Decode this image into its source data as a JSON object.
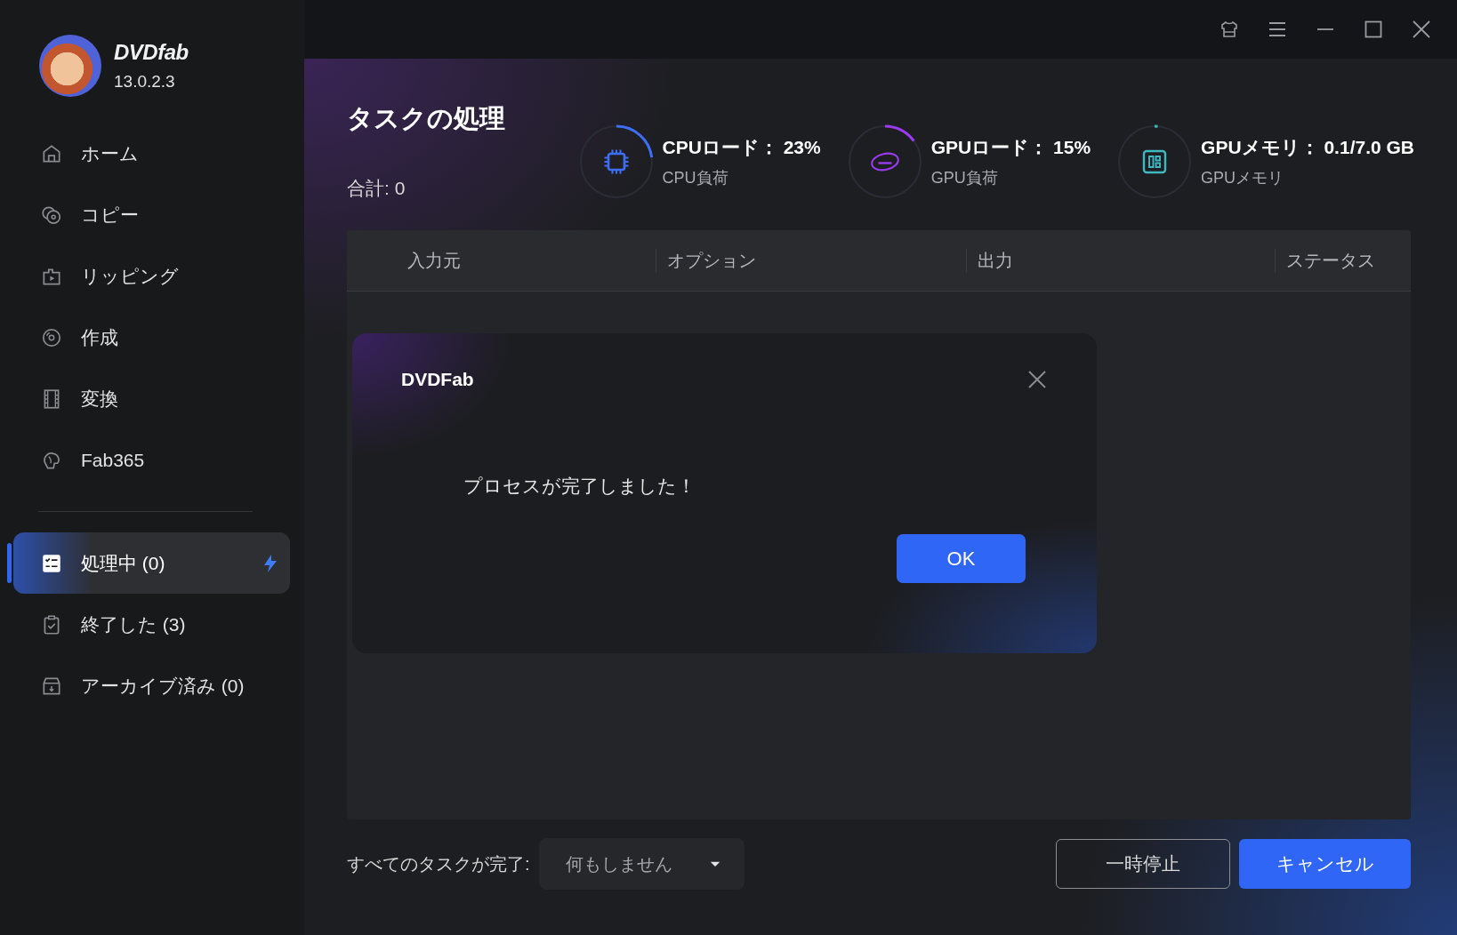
{
  "app": {
    "name": "DVDfab",
    "version": "13.0.2.3"
  },
  "sidebar": {
    "nav_items": [
      {
        "label": "ホーム",
        "selected": false
      },
      {
        "label": "コピー",
        "selected": false
      },
      {
        "label": "リッピング",
        "selected": false
      },
      {
        "label": "作成",
        "selected": false
      },
      {
        "label": "変換",
        "selected": false
      },
      {
        "label": "Fab365",
        "selected": false
      }
    ],
    "task_items": [
      {
        "label": "処理中 (0)",
        "selected": true
      },
      {
        "label": "終了した (3)",
        "selected": false
      },
      {
        "label": "アーカイブ済み (0)",
        "selected": false
      }
    ]
  },
  "page": {
    "title": "タスクの処理",
    "total": "合計: 0"
  },
  "meters": [
    {
      "title": "CPUロード： 23%",
      "subtitle": "CPU負荷",
      "level": 0.23,
      "color": "#3d6ef5"
    },
    {
      "title": "GPUロード： 15%",
      "subtitle": "GPU負荷",
      "level": 0.15,
      "color": "#9b3bf0"
    },
    {
      "title": "GPUメモリ： 0.1/7.0 GB",
      "subtitle": "GPUメモリ",
      "level": 0.014,
      "color": "#3fb8c0"
    }
  ],
  "table": {
    "columns": [
      "入力元",
      "オプション",
      "出力",
      "ステータス"
    ]
  },
  "dialog": {
    "title": "DVDFab",
    "message": "プロセスが完了しました！",
    "ok": "OK"
  },
  "footer": {
    "label": "すべてのタスクが完了:",
    "dropdown": {
      "value": "何もしません"
    },
    "buttons": [
      {
        "label": "一時停止",
        "kind": "outline"
      },
      {
        "label": "キャンセル",
        "kind": "primary"
      }
    ]
  }
}
